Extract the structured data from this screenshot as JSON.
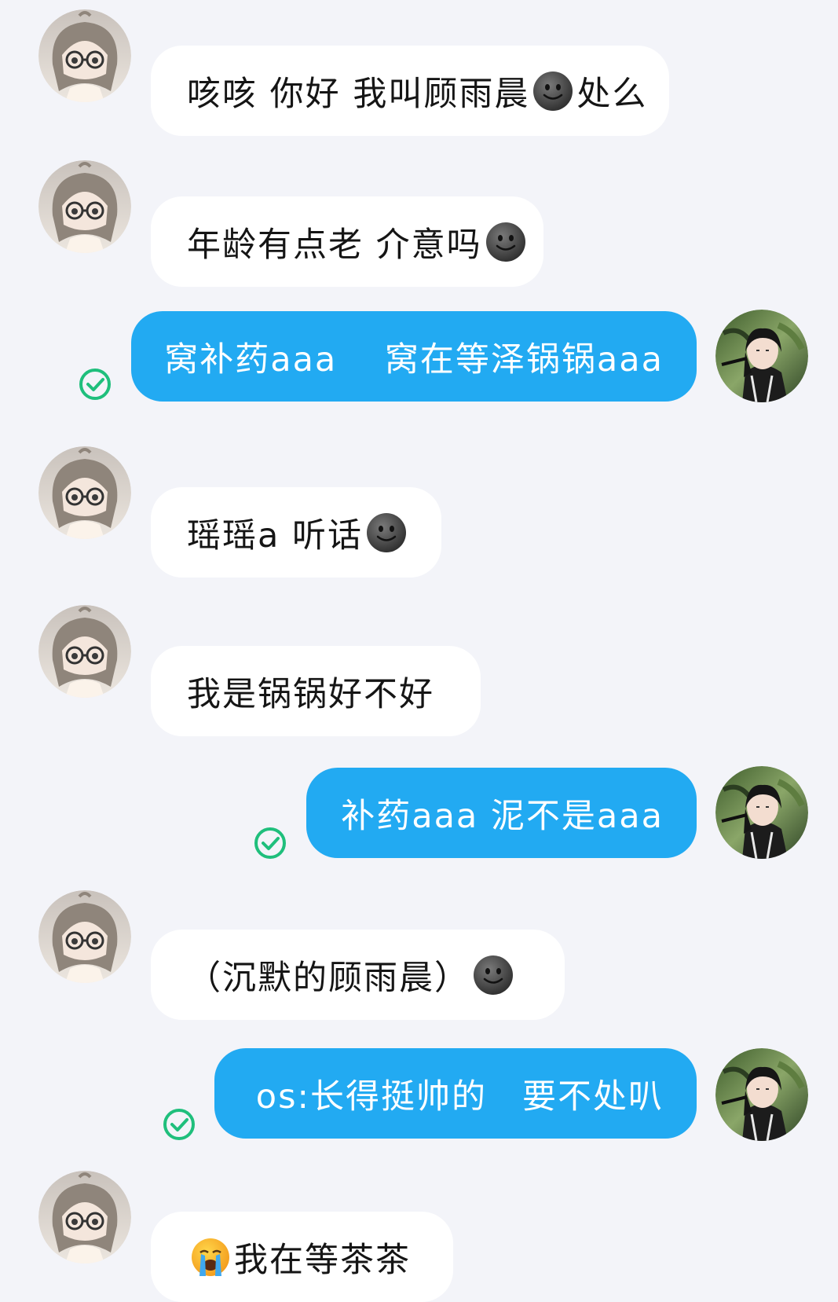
{
  "colors": {
    "background": "#f3f4f9",
    "incoming_bubble": "#ffffff",
    "outgoing_bubble": "#22aaf2",
    "read_check": "#1fbf7c"
  },
  "messages": [
    {
      "direction": "in",
      "parts": [
        "咳咳 你好 我叫顾雨晨",
        "emoji:smiling-dark-face",
        " 处么"
      ]
    },
    {
      "direction": "in",
      "parts": [
        "年龄有点老 介意吗",
        "emoji:smiling-dark-face"
      ]
    },
    {
      "direction": "out",
      "parts": [
        "窝补药aaa　 窝在等泽锅锅aaa"
      ],
      "status_icon": "read-check-icon"
    },
    {
      "direction": "in",
      "parts": [
        "瑶瑶a 听话",
        "emoji:smiling-dark-face"
      ]
    },
    {
      "direction": "in",
      "parts": [
        "我是锅锅好不好"
      ]
    },
    {
      "direction": "out",
      "parts": [
        "补药aaa  泥不是aaa"
      ],
      "status_icon": "read-check-icon"
    },
    {
      "direction": "in",
      "parts": [
        "（沉默的顾雨晨）",
        "emoji:smiling-dark-face"
      ]
    },
    {
      "direction": "out",
      "parts": [
        "os:长得挺帅的　要不处叭"
      ],
      "status_icon": "read-check-icon"
    },
    {
      "direction": "in",
      "parts": [
        "emoji:loudly-crying-face",
        "我在等茶茶"
      ]
    }
  ]
}
